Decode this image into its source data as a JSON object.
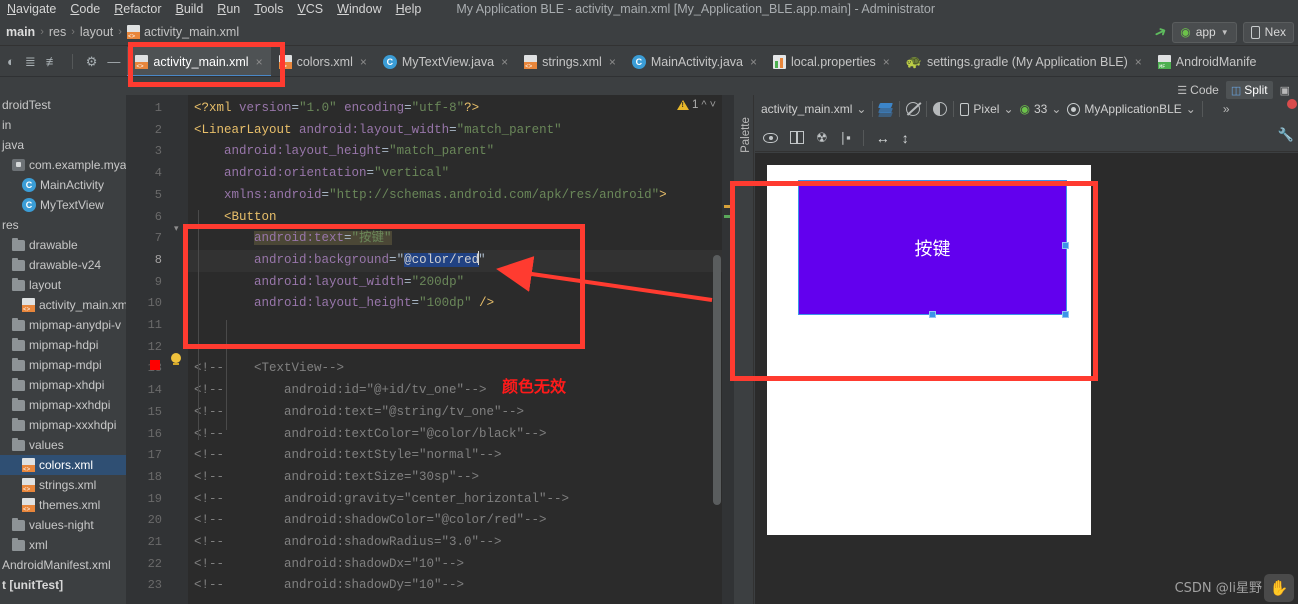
{
  "window": {
    "title": "My Application BLE - activity_main.xml [My_Application_BLE.app.main] - Administrator"
  },
  "menu": {
    "items": [
      {
        "label": "Navigate",
        "mnemonic": "N"
      },
      {
        "label": "Code",
        "mnemonic": "C"
      },
      {
        "label": "Refactor",
        "mnemonic": "R"
      },
      {
        "label": "Build",
        "mnemonic": "B"
      },
      {
        "label": "Run",
        "mnemonic": "R"
      },
      {
        "label": "Tools",
        "mnemonic": "T"
      },
      {
        "label": "VCS",
        "mnemonic": "V"
      },
      {
        "label": "Window",
        "mnemonic": "W"
      },
      {
        "label": "Help",
        "mnemonic": "H"
      }
    ]
  },
  "breadcrumb": {
    "items": [
      "main",
      "res",
      "layout",
      "activity_main.xml"
    ],
    "separator": "›"
  },
  "run_toolbar": {
    "config_label": "app",
    "device_label": "Nex",
    "caret": "▼"
  },
  "tabs": [
    {
      "label": "activity_main.xml",
      "icon": "xml-file-icon",
      "active": true,
      "close": "×"
    },
    {
      "label": "colors.xml",
      "icon": "xml-file-icon",
      "active": false,
      "close": "×"
    },
    {
      "label": "MyTextView.java",
      "icon": "java-class-icon",
      "active": false,
      "close": "×"
    },
    {
      "label": "strings.xml",
      "icon": "xml-file-icon",
      "active": false,
      "close": "×"
    },
    {
      "label": "MainActivity.java",
      "icon": "java-class-icon",
      "active": false,
      "close": "×"
    },
    {
      "label": "local.properties",
      "icon": "properties-file-icon",
      "active": false,
      "close": "×"
    },
    {
      "label": "settings.gradle (My Application BLE)",
      "icon": "gradle-icon",
      "active": false,
      "close": "×"
    },
    {
      "label": "AndroidManife",
      "icon": "manifest-file-icon",
      "active": false,
      "close": ""
    }
  ],
  "view_toggle": {
    "code_label": "Code",
    "split_label": "Split",
    "design_label": "",
    "selected": "Split"
  },
  "project_tree": [
    {
      "label": "droidTest",
      "icon": "none",
      "indent": 0,
      "selected": false,
      "bold": false
    },
    {
      "label": "in",
      "icon": "none",
      "indent": 0,
      "selected": false,
      "bold": false
    },
    {
      "label": "java",
      "icon": "none",
      "indent": 0,
      "selected": false,
      "bold": false
    },
    {
      "label": "com.example.myap",
      "icon": "package-icon",
      "indent": 1,
      "selected": false,
      "bold": false
    },
    {
      "label": "MainActivity",
      "icon": "java-class-icon",
      "indent": 2,
      "selected": false,
      "bold": false
    },
    {
      "label": "MyTextView",
      "icon": "java-class-icon",
      "indent": 2,
      "selected": false,
      "bold": false
    },
    {
      "label": "res",
      "icon": "none",
      "indent": 0,
      "selected": false,
      "bold": false
    },
    {
      "label": "drawable",
      "icon": "folder-icon",
      "indent": 1,
      "selected": false,
      "bold": false
    },
    {
      "label": "drawable-v24",
      "icon": "folder-icon",
      "indent": 1,
      "selected": false,
      "bold": false
    },
    {
      "label": "layout",
      "icon": "folder-icon",
      "indent": 1,
      "selected": false,
      "bold": false
    },
    {
      "label": "activity_main.xm",
      "icon": "xml-file-icon",
      "indent": 2,
      "selected": false,
      "bold": false
    },
    {
      "label": "mipmap-anydpi-v",
      "icon": "folder-icon",
      "indent": 1,
      "selected": false,
      "bold": false
    },
    {
      "label": "mipmap-hdpi",
      "icon": "folder-icon",
      "indent": 1,
      "selected": false,
      "bold": false
    },
    {
      "label": "mipmap-mdpi",
      "icon": "folder-icon",
      "indent": 1,
      "selected": false,
      "bold": false
    },
    {
      "label": "mipmap-xhdpi",
      "icon": "folder-icon",
      "indent": 1,
      "selected": false,
      "bold": false
    },
    {
      "label": "mipmap-xxhdpi",
      "icon": "folder-icon",
      "indent": 1,
      "selected": false,
      "bold": false
    },
    {
      "label": "mipmap-xxxhdpi",
      "icon": "folder-icon",
      "indent": 1,
      "selected": false,
      "bold": false
    },
    {
      "label": "values",
      "icon": "folder-icon",
      "indent": 1,
      "selected": false,
      "bold": false
    },
    {
      "label": "colors.xml",
      "icon": "xml-file-icon",
      "indent": 2,
      "selected": true,
      "bold": false
    },
    {
      "label": "strings.xml",
      "icon": "xml-file-icon",
      "indent": 2,
      "selected": false,
      "bold": false
    },
    {
      "label": "themes.xml",
      "icon": "xml-file-icon",
      "indent": 2,
      "selected": false,
      "bold": false
    },
    {
      "label": "values-night",
      "icon": "folder-icon",
      "indent": 1,
      "selected": false,
      "bold": false
    },
    {
      "label": "xml",
      "icon": "folder-icon",
      "indent": 1,
      "selected": false,
      "bold": false
    },
    {
      "label": "AndroidManifest.xml",
      "icon": "none",
      "indent": 0,
      "selected": false,
      "bold": false
    },
    {
      "label": "t [unitTest]",
      "icon": "none",
      "indent": 0,
      "selected": false,
      "bold": true
    }
  ],
  "editor": {
    "warning_count": "1",
    "line_numbers": [
      "1",
      "2",
      "3",
      "4",
      "5",
      "6",
      "7",
      "8",
      "9",
      "10",
      "11",
      "12",
      "13",
      "14",
      "15",
      "16",
      "17",
      "18",
      "19",
      "20",
      "21",
      "22",
      "23"
    ],
    "error_line": "8",
    "lines": [
      {
        "n": 1,
        "text": "<?xml version=\"1.0\" encoding=\"utf-8\"?>"
      },
      {
        "n": 2,
        "text": "<LinearLayout android:layout_width=\"match_parent\""
      },
      {
        "n": 3,
        "text": "    android:layout_height=\"match_parent\""
      },
      {
        "n": 4,
        "text": "    android:orientation=\"vertical\""
      },
      {
        "n": 5,
        "text": "    xmlns:android=\"http://schemas.android.com/apk/res/android\">"
      },
      {
        "n": 6,
        "text": "    <Button"
      },
      {
        "n": 7,
        "text": "        android:text=\"按键\""
      },
      {
        "n": 8,
        "text": "        android:background=\"@color/red\""
      },
      {
        "n": 9,
        "text": "        android:layout_width=\"200dp\""
      },
      {
        "n": 10,
        "text": "        android:layout_height=\"100dp\" />"
      },
      {
        "n": 11,
        "text": ""
      },
      {
        "n": 12,
        "text": ""
      },
      {
        "n": 13,
        "text": "<!--    <TextView-->"
      },
      {
        "n": 14,
        "text": "<!--        android:id=\"@+id/tv_one\"-->"
      },
      {
        "n": 15,
        "text": "<!--        android:text=\"@string/tv_one\"-->"
      },
      {
        "n": 16,
        "text": "<!--        android:textColor=\"@color/black\"-->"
      },
      {
        "n": 17,
        "text": "<!--        android:textStyle=\"normal\"-->"
      },
      {
        "n": 18,
        "text": "<!--        android:textSize=\"30sp\"-->"
      },
      {
        "n": 19,
        "text": "<!--        android:gravity=\"center_horizontal\"-->"
      },
      {
        "n": 20,
        "text": "<!--        android:shadowColor=\"@color/red\"-->"
      },
      {
        "n": 21,
        "text": "<!--        android:shadowRadius=\"3.0\"-->"
      },
      {
        "n": 22,
        "text": "<!--        android:shadowDx=\"10\"-->"
      },
      {
        "n": 23,
        "text": "<!--        android:shadowDy=\"10\"-->"
      }
    ]
  },
  "annotation": {
    "text": "颜色无效",
    "color": "#ff1a1a"
  },
  "design_panel": {
    "palette_label": "Palette",
    "file_label": "activity_main.xml",
    "device_label": "Pixel",
    "api_level": "33",
    "theme_label": "MyApplicationBLE",
    "overflow": "»",
    "caret": "⌄"
  },
  "preview": {
    "button_text": "按键",
    "button_color": "#6200ee",
    "selection_color": "#3c94e8",
    "device_background": "#ffffff"
  },
  "watermark": {
    "text": "CSDN @li星野",
    "badge_icon": "✋"
  },
  "colors": {
    "annotation_red": "#ff3b30",
    "editor_bg": "#2b2b2b",
    "ide_bg": "#3c3f41",
    "accent_blue": "#4a88c7"
  }
}
